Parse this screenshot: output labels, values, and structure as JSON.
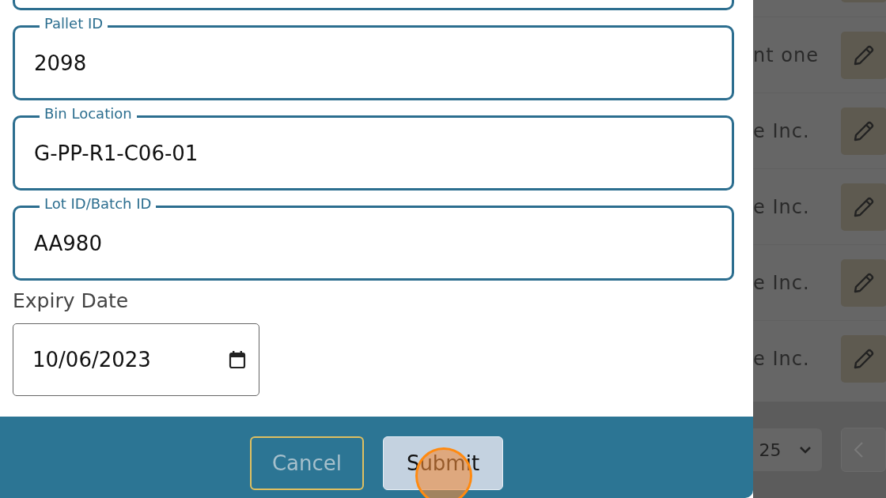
{
  "form": {
    "fields": [
      {
        "label": "Pallet ID",
        "value": "2098"
      },
      {
        "label": "Bin Location",
        "value": "G-PP-R1-C06-01"
      },
      {
        "label": "Lot ID/Batch ID",
        "value": "AA980"
      }
    ],
    "expiry": {
      "label": "Expiry Date",
      "value": "10/06/2023"
    },
    "buttons": [
      {
        "label": "Cancel",
        "kind": "secondary"
      },
      {
        "label": "Submit",
        "kind": "primary"
      }
    ]
  },
  "background": {
    "rows": [
      {
        "text": "nt one"
      },
      {
        "text": "e Inc."
      },
      {
        "text": "e Inc."
      },
      {
        "text": "e Inc."
      },
      {
        "text": "e Inc."
      }
    ],
    "page_size": "25"
  }
}
